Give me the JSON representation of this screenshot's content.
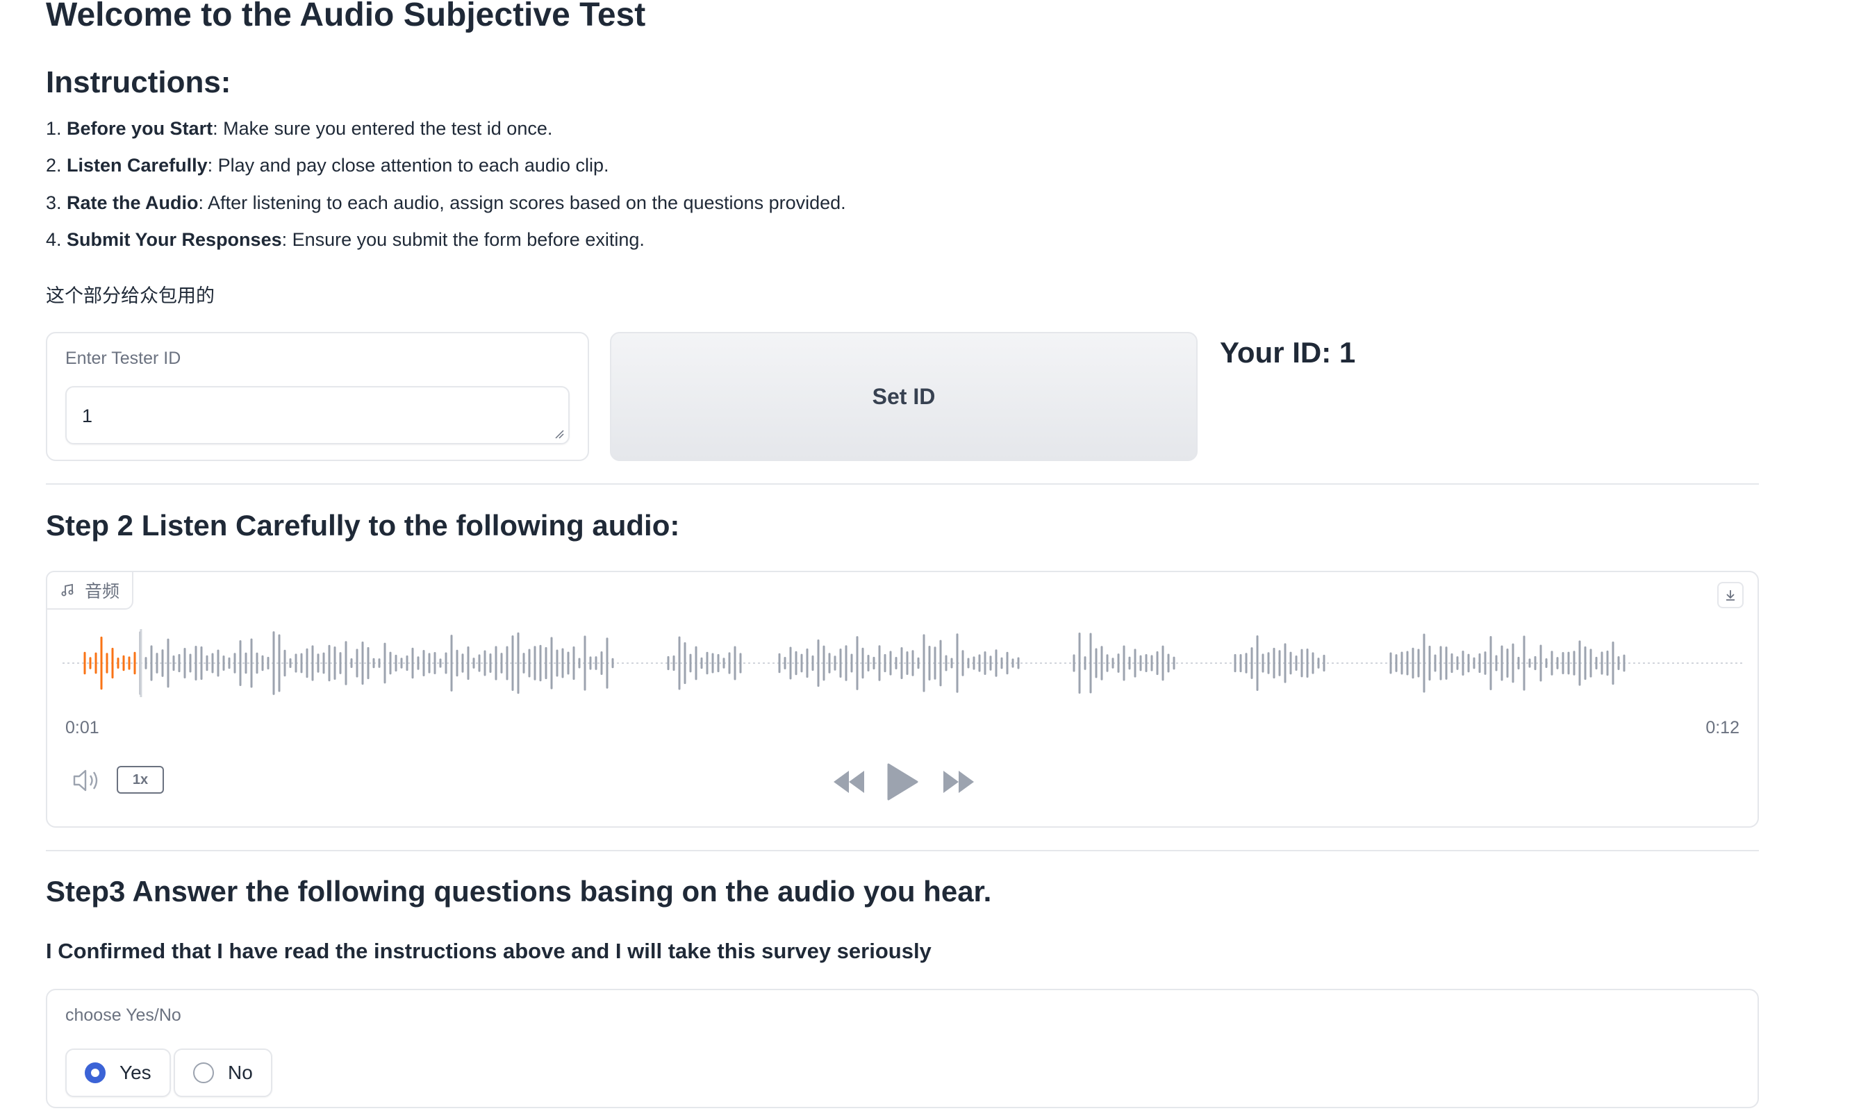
{
  "page": {
    "title": "Welcome to the Audio Subjective Test",
    "instructions_heading": "Instructions:",
    "instructions": [
      {
        "num": "1. ",
        "bold": "Before you Start",
        "rest": ": Make sure you entered the test id once."
      },
      {
        "num": "2. ",
        "bold": "Listen Carefully",
        "rest": ": Play and pay close attention to each audio clip."
      },
      {
        "num": "3. ",
        "bold": "Rate the Audio",
        "rest": ": After listening to each audio, assign scores based on the questions provided."
      },
      {
        "num": "4. ",
        "bold": "Submit Your Responses",
        "rest": ": Ensure you submit the form before exiting."
      }
    ],
    "note": "这个部分给众包用的"
  },
  "tester": {
    "label": "Enter Tester ID",
    "value": "1",
    "set_button": "Set ID",
    "your_id": "Your ID: 1"
  },
  "step2": {
    "heading": "Step 2 Listen Carefully to the following audio:",
    "audio": {
      "tag_label": "音频",
      "current_time": "0:01",
      "duration": "0:12",
      "speed": "1x",
      "progress_fraction": 0.045,
      "colors": {
        "played": "#f97316",
        "unplayed": "#9ca3af"
      }
    }
  },
  "step3": {
    "heading": "Step3 Answer the following questions basing on the audio you hear.",
    "question": "I Confirmed that I have read the instructions above and I will take this survey seriously",
    "radio_label": "choose Yes/No",
    "options": [
      {
        "label": "Yes",
        "selected": true
      },
      {
        "label": "No",
        "selected": false
      }
    ],
    "accent": "#3b63d6"
  }
}
